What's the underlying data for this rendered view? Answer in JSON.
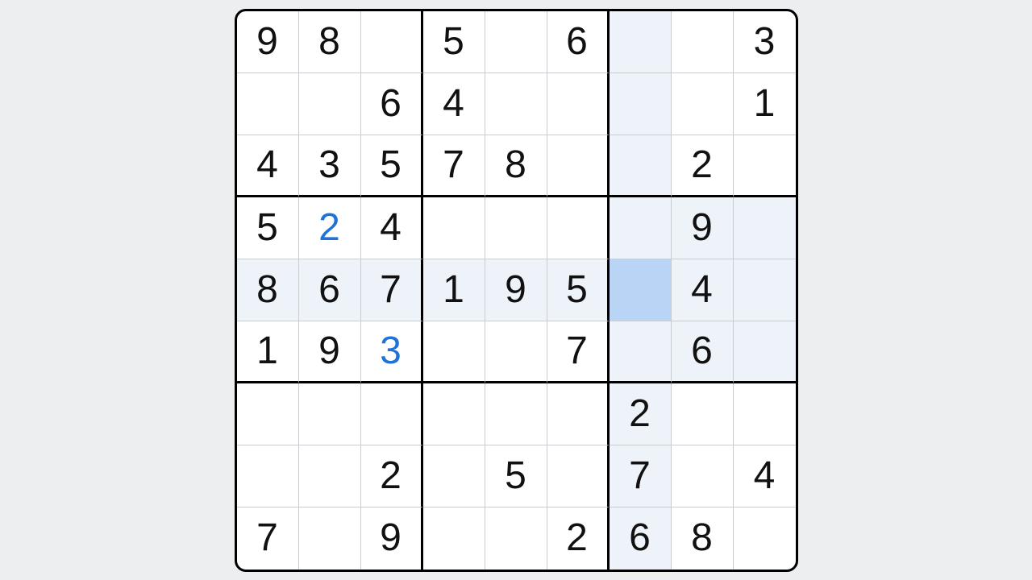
{
  "sudoku": {
    "selected": [
      4,
      6
    ],
    "highlight_row": 4,
    "highlight_col": 6,
    "highlight_box": [
      3,
      6
    ],
    "grid": [
      [
        {
          "v": "9",
          "t": "given"
        },
        {
          "v": "8",
          "t": "given"
        },
        {
          "v": "",
          "t": "empty"
        },
        {
          "v": "5",
          "t": "given"
        },
        {
          "v": "",
          "t": "empty"
        },
        {
          "v": "6",
          "t": "given"
        },
        {
          "v": "",
          "t": "empty"
        },
        {
          "v": "",
          "t": "empty"
        },
        {
          "v": "3",
          "t": "given"
        }
      ],
      [
        {
          "v": "",
          "t": "empty"
        },
        {
          "v": "",
          "t": "empty"
        },
        {
          "v": "6",
          "t": "given"
        },
        {
          "v": "4",
          "t": "given"
        },
        {
          "v": "",
          "t": "empty"
        },
        {
          "v": "",
          "t": "empty"
        },
        {
          "v": "",
          "t": "empty"
        },
        {
          "v": "",
          "t": "empty"
        },
        {
          "v": "1",
          "t": "given"
        }
      ],
      [
        {
          "v": "4",
          "t": "given"
        },
        {
          "v": "3",
          "t": "given"
        },
        {
          "v": "5",
          "t": "given"
        },
        {
          "v": "7",
          "t": "given"
        },
        {
          "v": "8",
          "t": "given"
        },
        {
          "v": "",
          "t": "empty"
        },
        {
          "v": "",
          "t": "empty"
        },
        {
          "v": "2",
          "t": "given"
        },
        {
          "v": "",
          "t": "empty"
        }
      ],
      [
        {
          "v": "5",
          "t": "given"
        },
        {
          "v": "2",
          "t": "entry"
        },
        {
          "v": "4",
          "t": "given"
        },
        {
          "v": "",
          "t": "empty"
        },
        {
          "v": "",
          "t": "empty"
        },
        {
          "v": "",
          "t": "empty"
        },
        {
          "v": "",
          "t": "empty"
        },
        {
          "v": "9",
          "t": "given"
        },
        {
          "v": "",
          "t": "empty"
        }
      ],
      [
        {
          "v": "8",
          "t": "given"
        },
        {
          "v": "6",
          "t": "given"
        },
        {
          "v": "7",
          "t": "given"
        },
        {
          "v": "1",
          "t": "given"
        },
        {
          "v": "9",
          "t": "given"
        },
        {
          "v": "5",
          "t": "given"
        },
        {
          "v": "",
          "t": "empty"
        },
        {
          "v": "4",
          "t": "given"
        },
        {
          "v": "",
          "t": "empty"
        }
      ],
      [
        {
          "v": "1",
          "t": "given"
        },
        {
          "v": "9",
          "t": "given"
        },
        {
          "v": "3",
          "t": "entry"
        },
        {
          "v": "",
          "t": "empty"
        },
        {
          "v": "",
          "t": "empty"
        },
        {
          "v": "7",
          "t": "given"
        },
        {
          "v": "",
          "t": "empty"
        },
        {
          "v": "6",
          "t": "given"
        },
        {
          "v": "",
          "t": "empty"
        }
      ],
      [
        {
          "v": "",
          "t": "empty"
        },
        {
          "v": "",
          "t": "empty"
        },
        {
          "v": "",
          "t": "empty"
        },
        {
          "v": "",
          "t": "empty"
        },
        {
          "v": "",
          "t": "empty"
        },
        {
          "v": "",
          "t": "empty"
        },
        {
          "v": "2",
          "t": "given"
        },
        {
          "v": "",
          "t": "empty"
        },
        {
          "v": "",
          "t": "empty"
        }
      ],
      [
        {
          "v": "",
          "t": "empty"
        },
        {
          "v": "",
          "t": "empty"
        },
        {
          "v": "2",
          "t": "given"
        },
        {
          "v": "",
          "t": "empty"
        },
        {
          "v": "5",
          "t": "given"
        },
        {
          "v": "",
          "t": "empty"
        },
        {
          "v": "7",
          "t": "given"
        },
        {
          "v": "",
          "t": "empty"
        },
        {
          "v": "4",
          "t": "given"
        }
      ],
      [
        {
          "v": "7",
          "t": "given"
        },
        {
          "v": "",
          "t": "empty"
        },
        {
          "v": "9",
          "t": "given"
        },
        {
          "v": "",
          "t": "empty"
        },
        {
          "v": "",
          "t": "empty"
        },
        {
          "v": "2",
          "t": "given"
        },
        {
          "v": "6",
          "t": "given"
        },
        {
          "v": "8",
          "t": "given"
        },
        {
          "v": "",
          "t": "empty"
        }
      ]
    ]
  }
}
